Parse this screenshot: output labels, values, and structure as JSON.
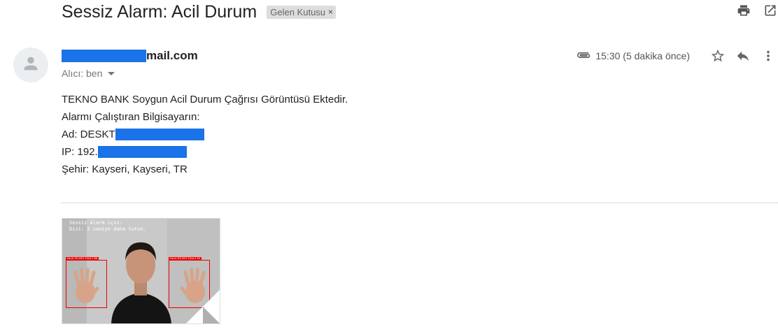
{
  "email": {
    "subject": "Sessiz Alarm: Acil Durum",
    "label": "Gelen Kutusu",
    "label_close": "×",
    "sender": {
      "domain": "mail.com"
    },
    "recipient": "Alıcı: ben",
    "time": "15:30 (5 dakika önce)",
    "body": {
      "line1": "TEKNO BANK Soygun Acil Durum Çağrısı Görüntüsü Ektedir.",
      "line2": "Alarmı Çalıştıran Bilgisayarın:",
      "ad_prefix": "Ad: DESKT",
      "ip_prefix": "IP: 192.",
      "city": "Şehir: Kayseri, Kayseri, TR"
    },
    "attachment": {
      "overlay_line1": "Sessiz Alarm için:",
      "overlay_line2": "Dizi: 2 saniye daha tutun.",
      "left_label": "hand: 90,00% Time:1.86",
      "right_label": "hand: 85,00% Time:4.05"
    }
  },
  "icons": [
    "print-icon",
    "open-in-new-icon",
    "avatar-person-icon",
    "attachment-clip-icon",
    "star-icon",
    "reply-icon",
    "more-vert-icon",
    "caret-down-icon"
  ],
  "colors": {
    "redaction": "#1a73e8",
    "label_bg": "#dddddd",
    "detection_box": "#ee0000"
  }
}
